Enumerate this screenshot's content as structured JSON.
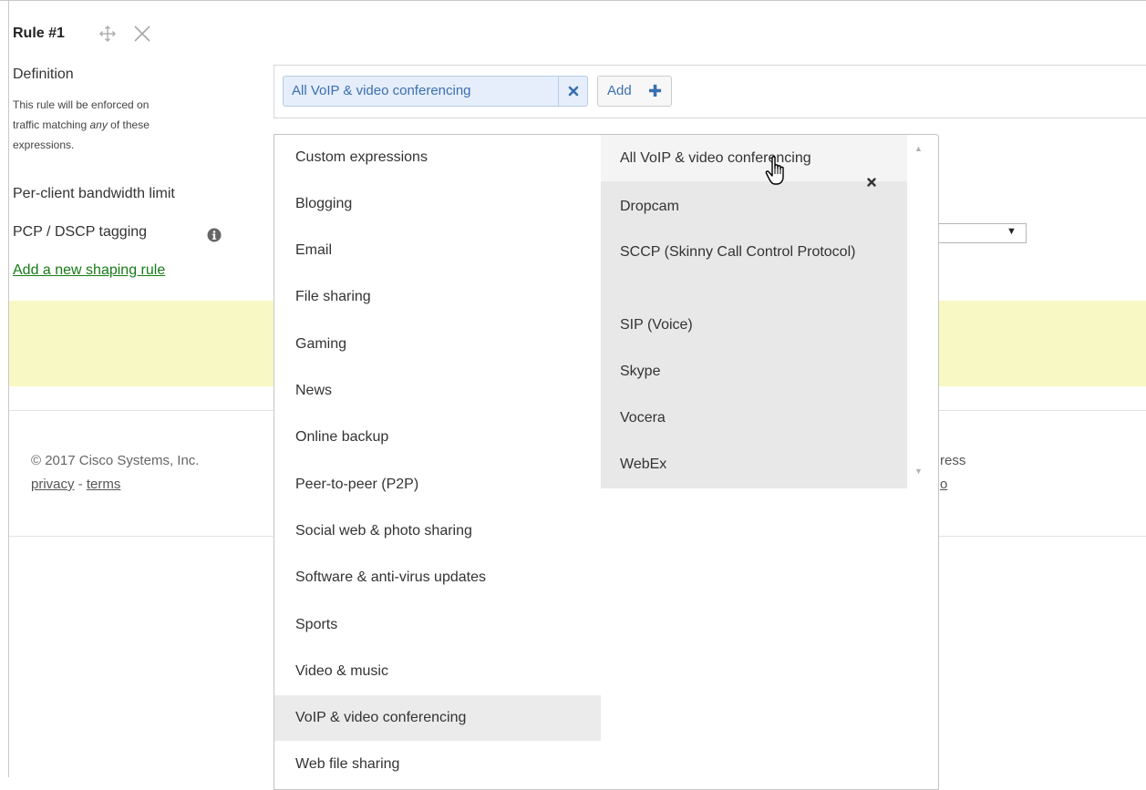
{
  "rule": {
    "title": "Rule #1",
    "move_icon": "move-arrows-icon",
    "close_icon": "close-icon"
  },
  "form": {
    "definition_label": "Definition",
    "definition_desc_1": "This rule will be enforced on",
    "definition_desc_2": "traffic matching ",
    "definition_desc_any": "any",
    "definition_desc_3": " of these",
    "definition_desc_4": "expressions.",
    "bandwidth_label": "Per-client bandwidth limit",
    "pcp_label": "PCP / DSCP tagging",
    "info_icon": "info-icon",
    "add_rule_link": "Add a new shaping rule"
  },
  "definition_box": {
    "tag_label": "All VoIP & video conferencing",
    "tag_remove_icon": "remove-x-icon",
    "add_button_label": "Add",
    "add_button_icon": "plus-icon"
  },
  "footer": {
    "copyright": "© 2017 Cisco Systems, Inc.",
    "privacy": "privacy",
    "separator": " - ",
    "terms": "terms",
    "right_fragment_1": "ress",
    "right_fragment_2": "o"
  },
  "dropdown": {
    "categories": [
      "Custom expressions",
      "Blogging",
      "Email",
      "File sharing",
      "Gaming",
      "News",
      "Online backup",
      "Peer-to-peer (P2P)",
      "Social web & photo sharing",
      "Software & anti-virus updates",
      "Sports",
      "Video & music",
      "VoIP & video conferencing",
      "Web file sharing"
    ],
    "active_category": "VoIP & video conferencing",
    "apps": [
      "All VoIP & video conferencing",
      "Dropcam",
      "SCCP (Skinny Call Control Protocol)",
      "SIP (Voice)",
      "Skype",
      "Vocera",
      "WebEx"
    ],
    "app_remove_icon": "remove-x-icon",
    "scroll_up_icon": "scroll-up-arrow-icon",
    "scroll_down_icon": "scroll-down-arrow-icon"
  },
  "colors": {
    "link_green": "#167a16",
    "tag_blue": "#3a6fb0",
    "highlight_yellow": "#f8f8c4"
  }
}
